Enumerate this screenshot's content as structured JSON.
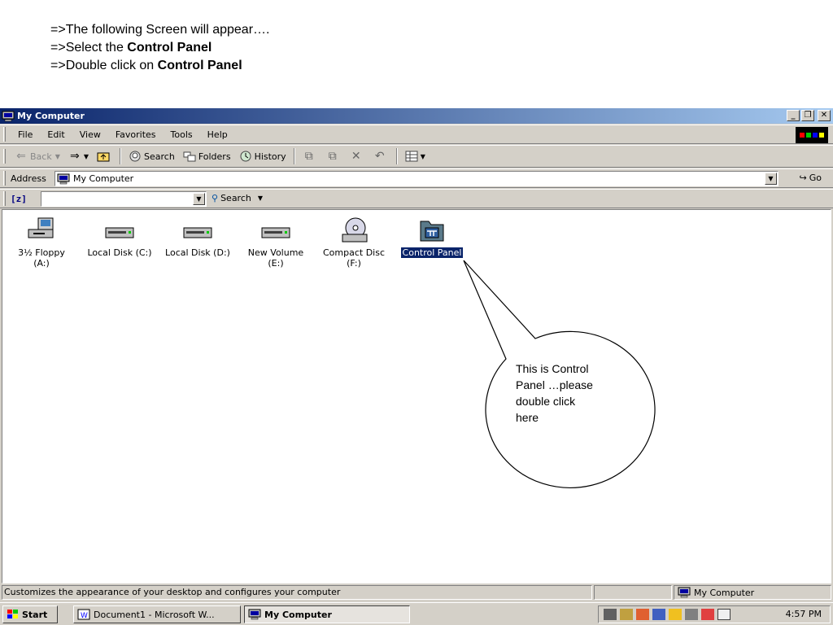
{
  "instructions": {
    "line1": "=>The following Screen will appear….",
    "line2_prefix": "=>Select the ",
    "line2_bold": "Control Panel",
    "line3_prefix": "=>Double click on ",
    "line3_bold": "Control Panel"
  },
  "window": {
    "title": "My Computer",
    "title_icon": "my-computer-icon",
    "buttons": [
      "minimize",
      "restore",
      "close"
    ]
  },
  "menubar": {
    "items": [
      "File",
      "Edit",
      "View",
      "Favorites",
      "Tools",
      "Help"
    ]
  },
  "toolbar": {
    "back_label": "Back",
    "search_label": "Search",
    "folders_label": "Folders",
    "history_label": "History"
  },
  "address": {
    "label": "Address",
    "value": "My Computer",
    "go_label": "Go"
  },
  "searchbar": {
    "z_label": "[z]",
    "value": "",
    "search_label": "Search"
  },
  "drives": [
    {
      "line1": "3½ Floppy",
      "line2": "(A:)",
      "icon": "floppy-drive-icon"
    },
    {
      "line1": "Local Disk (C:)",
      "line2": "",
      "icon": "hard-disk-icon"
    },
    {
      "line1": "Local Disk (D:)",
      "line2": "",
      "icon": "hard-disk-icon"
    },
    {
      "line1": "New Volume",
      "line2": "(E:)",
      "icon": "hard-disk-icon"
    },
    {
      "line1": "Compact Disc",
      "line2": "(F:)",
      "icon": "cd-drive-icon"
    },
    {
      "line1": "Control Panel",
      "line2": "",
      "icon": "control-panel-icon",
      "selected": true
    }
  ],
  "callout": {
    "text_lines": [
      "This is Control",
      "Panel …please",
      "double click",
      "here"
    ]
  },
  "statusbar": {
    "message": "Customizes the appearance of your desktop and configures your computer",
    "zone": "My Computer"
  },
  "taskbar": {
    "start_label": "Start",
    "tasks": [
      {
        "label": "Document1 - Microsoft W...",
        "active": false
      },
      {
        "label": "My Computer",
        "active": true
      }
    ],
    "clock": "4:57 PM"
  },
  "colors": {
    "title_gradient_start": "#0a246a",
    "title_gradient_end": "#a6caf0",
    "selection": "#0a246a",
    "chrome": "#d4d0c8"
  }
}
